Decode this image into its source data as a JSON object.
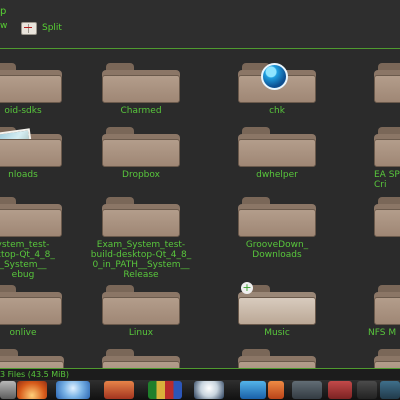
{
  "toolbar": {
    "title_fragment": "p",
    "view_fragment": "w",
    "split_label": "Split"
  },
  "files": [
    {
      "label": "oid-sdks",
      "icon": "folder-icon"
    },
    {
      "label": "Charmed",
      "icon": "folder-icon"
    },
    {
      "label": "chk",
      "icon": "folder-globe-icon"
    },
    {
      "label": "",
      "icon": "folder-icon"
    },
    {
      "label": "nloads",
      "icon": "folder-photo-icon"
    },
    {
      "label": "Dropbox",
      "icon": "folder-icon"
    },
    {
      "label": "dwhelper",
      "icon": "folder-icon"
    },
    {
      "label": "EA SP\nCri",
      "icon": "folder-icon"
    },
    {
      "label": "ystem_test-\nsktop-Qt_4_8_\n_System__\nebug",
      "icon": "folder-icon"
    },
    {
      "label": "Exam_System_test-\nbuild-desktop-Qt_4_8_\n0_in_PATH__System__\nRelease",
      "icon": "folder-icon"
    },
    {
      "label": "GrooveDown_\nDownloads",
      "icon": "folder-icon"
    },
    {
      "label": "",
      "icon": "folder-icon"
    },
    {
      "label": "onlive",
      "icon": "folder-icon"
    },
    {
      "label": "Linux",
      "icon": "folder-icon"
    },
    {
      "label": "Music",
      "icon": "folder-plus-icon"
    },
    {
      "label": "NFS M",
      "icon": "folder-icon"
    }
  ],
  "status": {
    "text": "3 Files (43.5 MiB)"
  },
  "taskbar": {
    "icons": [
      "app-icon",
      "launcher-icon",
      "browser-icon",
      "mail-icon",
      "game-icon",
      "media-icon",
      "folder-icon",
      "app-icon",
      "app-icon",
      "app-icon",
      "app-icon",
      "app-icon"
    ]
  }
}
